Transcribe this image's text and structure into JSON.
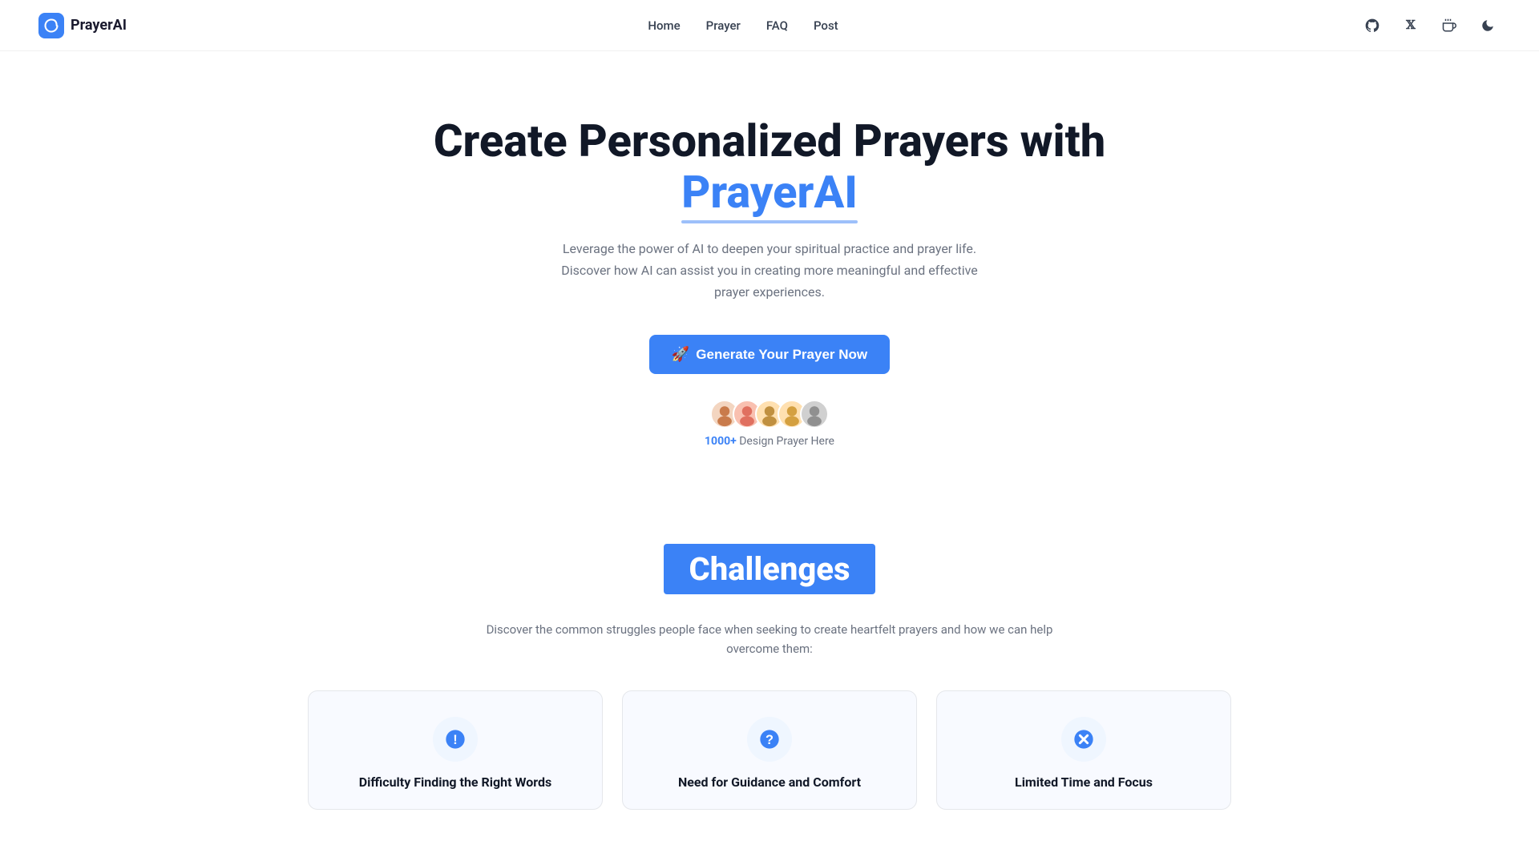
{
  "nav": {
    "logo_text": "PrayerAI",
    "links": [
      {
        "label": "Home",
        "href": "#"
      },
      {
        "label": "Prayer",
        "href": "#"
      },
      {
        "label": "FAQ",
        "href": "#"
      },
      {
        "label": "Post",
        "href": "#"
      }
    ],
    "icons": [
      {
        "name": "github-icon",
        "symbol": "⌥"
      },
      {
        "name": "x-twitter-icon",
        "symbol": "𝕏"
      },
      {
        "name": "cup-icon",
        "symbol": "☕"
      },
      {
        "name": "dark-mode-icon",
        "symbol": "🌙"
      }
    ]
  },
  "hero": {
    "title_line1": "Create Personalized Prayers with",
    "title_brand": "PrayerAI",
    "subtitle": "Leverage the power of AI to deepen your spiritual practice and prayer life. Discover how AI can assist you in creating more meaningful and effective prayer experiences.",
    "cta_label": "Generate Your Prayer Now",
    "social_proof": {
      "count": "1000+",
      "suffix": " Design Prayer Here"
    },
    "avatars": [
      "🧑",
      "👩",
      "👨",
      "🧑",
      "👤"
    ]
  },
  "challenges": {
    "badge_label": "Challenges",
    "subtitle": "Discover the common struggles people face when seeking to create heartfelt prayers and how we can help overcome them:",
    "cards": [
      {
        "icon_type": "exclaim",
        "title": "Difficulty Finding the Right Words"
      },
      {
        "icon_type": "question",
        "title": "Need for Guidance and Comfort"
      },
      {
        "icon_type": "x",
        "title": "Limited Time and Focus"
      }
    ]
  }
}
